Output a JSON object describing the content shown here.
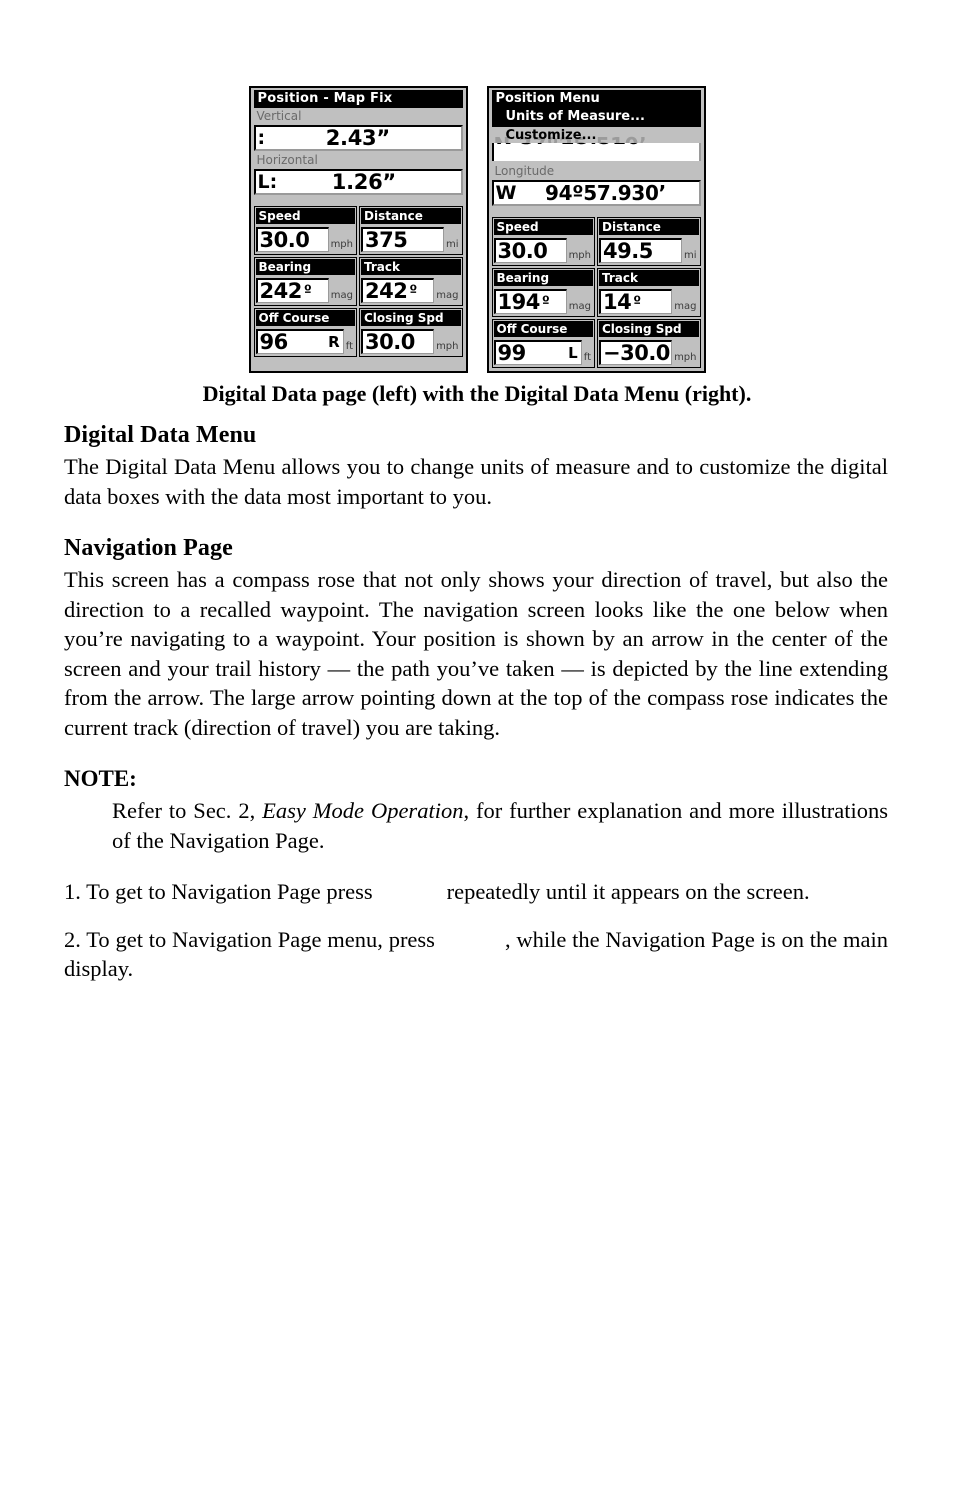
{
  "figure": {
    "caption": "Digital Data page (left) with the Digital Data Menu (right).",
    "left_screen": {
      "name": "Digital Data page",
      "title": "Position - Map Fix",
      "field1_label": "Vertical",
      "field1_prefix": ":",
      "field1_value": "2.43”",
      "field2_label": "Horizontal",
      "field2_prefix": "L:",
      "field2_value": "1.26”",
      "boxes": [
        {
          "header": "Speed",
          "value": "30.0",
          "side": "",
          "units": "mph"
        },
        {
          "header": "Distance",
          "value": "375",
          "side": "",
          "units": "mi"
        },
        {
          "header": "Bearing",
          "value": "242",
          "deg": "º",
          "side": "",
          "units": "mag"
        },
        {
          "header": "Track",
          "value": "242",
          "deg": "º",
          "side": "",
          "units": "mag"
        },
        {
          "header": "Off Course",
          "value": "96",
          "side": "R",
          "units": "ft"
        },
        {
          "header": "Closing Spd",
          "value": "30.0",
          "side": "",
          "units": "mph"
        }
      ]
    },
    "right_screen": {
      "name": "Digital Data Menu",
      "menu_title": "Position Menu",
      "menu_items": [
        {
          "label": "Units of Measure...",
          "selected": true
        },
        {
          "label": "Customize...",
          "selected": false
        }
      ],
      "ghost_latitude": "N   37º25.510’",
      "field2_label": "Longitude",
      "field2_prefix": "W",
      "field2_value": "94º57.930’",
      "boxes": [
        {
          "header": "Speed",
          "value": "30.0",
          "side": "",
          "units": "mph"
        },
        {
          "header": "Distance",
          "value": "49.5",
          "side": "",
          "units": "mi"
        },
        {
          "header": "Bearing",
          "value": "194",
          "deg": "º",
          "side": "",
          "units": "mag"
        },
        {
          "header": "Track",
          "value": "14",
          "deg": "º",
          "side": "",
          "units": "mag"
        },
        {
          "header": "Off Course",
          "value": "99",
          "side": "L",
          "units": "ft"
        },
        {
          "header": "Closing Spd",
          "value": "−30.0",
          "side": "",
          "units": "mph"
        }
      ]
    }
  },
  "content": {
    "section1_heading": "Digital Data Menu",
    "section1_body": "The Digital Data Menu allows you to change units of measure and to customize the digital data boxes with the data most important to you.",
    "section2_heading": "Navigation Page",
    "section2_body": "This screen has a compass rose that not only shows your direction of travel, but also the direction to a recalled waypoint. The navigation screen looks like the one below when you’re navigating to a waypoint. Your position is shown by an arrow in the center of the screen and your trail history — the path you’ve taken — is depicted by the line extending from the arrow. The large arrow pointing down at the top of the compass rose indicates the current track (direction of travel) you are taking.",
    "note_label": "NOTE:",
    "note_text_before": "Refer to Sec. 2, ",
    "note_text_italic": "Easy Mode Operation",
    "note_text_after": ", for further explanation and more illustrations of the Navigation Page.",
    "step1_before": "1. To get to Navigation Page press",
    "step1_after": "repeatedly until it appears on the screen.",
    "step2_before": "2. To get to Navigation Page menu, press",
    "step2_after": ", while the Navigation Page is on the main display."
  },
  "colors": {
    "lcd_background": "#c0c0c0",
    "lcd_ink": "#000000",
    "lcd_field": "#ffffff",
    "lcd_dim": "#6a6a6a",
    "page_background": "#ffffff"
  }
}
